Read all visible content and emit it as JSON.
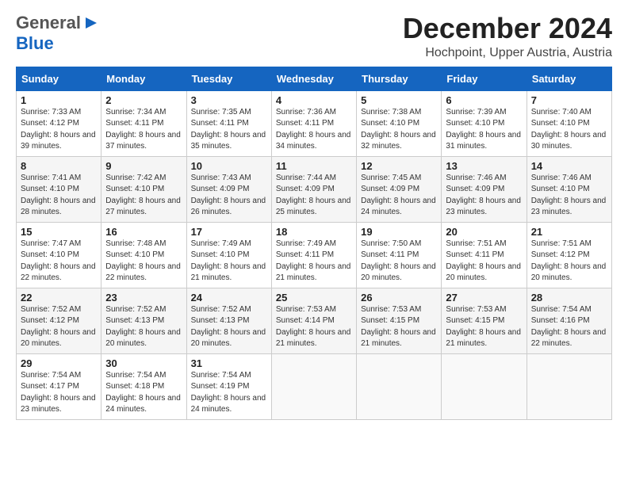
{
  "header": {
    "logo_general": "General",
    "logo_blue": "Blue",
    "title": "December 2024",
    "location": "Hochpoint, Upper Austria, Austria"
  },
  "weekdays": [
    "Sunday",
    "Monday",
    "Tuesday",
    "Wednesday",
    "Thursday",
    "Friday",
    "Saturday"
  ],
  "weeks": [
    [
      {
        "day": "1",
        "sunrise": "Sunrise: 7:33 AM",
        "sunset": "Sunset: 4:12 PM",
        "daylight": "Daylight: 8 hours and 39 minutes."
      },
      {
        "day": "2",
        "sunrise": "Sunrise: 7:34 AM",
        "sunset": "Sunset: 4:11 PM",
        "daylight": "Daylight: 8 hours and 37 minutes."
      },
      {
        "day": "3",
        "sunrise": "Sunrise: 7:35 AM",
        "sunset": "Sunset: 4:11 PM",
        "daylight": "Daylight: 8 hours and 35 minutes."
      },
      {
        "day": "4",
        "sunrise": "Sunrise: 7:36 AM",
        "sunset": "Sunset: 4:11 PM",
        "daylight": "Daylight: 8 hours and 34 minutes."
      },
      {
        "day": "5",
        "sunrise": "Sunrise: 7:38 AM",
        "sunset": "Sunset: 4:10 PM",
        "daylight": "Daylight: 8 hours and 32 minutes."
      },
      {
        "day": "6",
        "sunrise": "Sunrise: 7:39 AM",
        "sunset": "Sunset: 4:10 PM",
        "daylight": "Daylight: 8 hours and 31 minutes."
      },
      {
        "day": "7",
        "sunrise": "Sunrise: 7:40 AM",
        "sunset": "Sunset: 4:10 PM",
        "daylight": "Daylight: 8 hours and 30 minutes."
      }
    ],
    [
      {
        "day": "8",
        "sunrise": "Sunrise: 7:41 AM",
        "sunset": "Sunset: 4:10 PM",
        "daylight": "Daylight: 8 hours and 28 minutes."
      },
      {
        "day": "9",
        "sunrise": "Sunrise: 7:42 AM",
        "sunset": "Sunset: 4:10 PM",
        "daylight": "Daylight: 8 hours and 27 minutes."
      },
      {
        "day": "10",
        "sunrise": "Sunrise: 7:43 AM",
        "sunset": "Sunset: 4:09 PM",
        "daylight": "Daylight: 8 hours and 26 minutes."
      },
      {
        "day": "11",
        "sunrise": "Sunrise: 7:44 AM",
        "sunset": "Sunset: 4:09 PM",
        "daylight": "Daylight: 8 hours and 25 minutes."
      },
      {
        "day": "12",
        "sunrise": "Sunrise: 7:45 AM",
        "sunset": "Sunset: 4:09 PM",
        "daylight": "Daylight: 8 hours and 24 minutes."
      },
      {
        "day": "13",
        "sunrise": "Sunrise: 7:46 AM",
        "sunset": "Sunset: 4:09 PM",
        "daylight": "Daylight: 8 hours and 23 minutes."
      },
      {
        "day": "14",
        "sunrise": "Sunrise: 7:46 AM",
        "sunset": "Sunset: 4:10 PM",
        "daylight": "Daylight: 8 hours and 23 minutes."
      }
    ],
    [
      {
        "day": "15",
        "sunrise": "Sunrise: 7:47 AM",
        "sunset": "Sunset: 4:10 PM",
        "daylight": "Daylight: 8 hours and 22 minutes."
      },
      {
        "day": "16",
        "sunrise": "Sunrise: 7:48 AM",
        "sunset": "Sunset: 4:10 PM",
        "daylight": "Daylight: 8 hours and 22 minutes."
      },
      {
        "day": "17",
        "sunrise": "Sunrise: 7:49 AM",
        "sunset": "Sunset: 4:10 PM",
        "daylight": "Daylight: 8 hours and 21 minutes."
      },
      {
        "day": "18",
        "sunrise": "Sunrise: 7:49 AM",
        "sunset": "Sunset: 4:11 PM",
        "daylight": "Daylight: 8 hours and 21 minutes."
      },
      {
        "day": "19",
        "sunrise": "Sunrise: 7:50 AM",
        "sunset": "Sunset: 4:11 PM",
        "daylight": "Daylight: 8 hours and 20 minutes."
      },
      {
        "day": "20",
        "sunrise": "Sunrise: 7:51 AM",
        "sunset": "Sunset: 4:11 PM",
        "daylight": "Daylight: 8 hours and 20 minutes."
      },
      {
        "day": "21",
        "sunrise": "Sunrise: 7:51 AM",
        "sunset": "Sunset: 4:12 PM",
        "daylight": "Daylight: 8 hours and 20 minutes."
      }
    ],
    [
      {
        "day": "22",
        "sunrise": "Sunrise: 7:52 AM",
        "sunset": "Sunset: 4:12 PM",
        "daylight": "Daylight: 8 hours and 20 minutes."
      },
      {
        "day": "23",
        "sunrise": "Sunrise: 7:52 AM",
        "sunset": "Sunset: 4:13 PM",
        "daylight": "Daylight: 8 hours and 20 minutes."
      },
      {
        "day": "24",
        "sunrise": "Sunrise: 7:52 AM",
        "sunset": "Sunset: 4:13 PM",
        "daylight": "Daylight: 8 hours and 20 minutes."
      },
      {
        "day": "25",
        "sunrise": "Sunrise: 7:53 AM",
        "sunset": "Sunset: 4:14 PM",
        "daylight": "Daylight: 8 hours and 21 minutes."
      },
      {
        "day": "26",
        "sunrise": "Sunrise: 7:53 AM",
        "sunset": "Sunset: 4:15 PM",
        "daylight": "Daylight: 8 hours and 21 minutes."
      },
      {
        "day": "27",
        "sunrise": "Sunrise: 7:53 AM",
        "sunset": "Sunset: 4:15 PM",
        "daylight": "Daylight: 8 hours and 21 minutes."
      },
      {
        "day": "28",
        "sunrise": "Sunrise: 7:54 AM",
        "sunset": "Sunset: 4:16 PM",
        "daylight": "Daylight: 8 hours and 22 minutes."
      }
    ],
    [
      {
        "day": "29",
        "sunrise": "Sunrise: 7:54 AM",
        "sunset": "Sunset: 4:17 PM",
        "daylight": "Daylight: 8 hours and 23 minutes."
      },
      {
        "day": "30",
        "sunrise": "Sunrise: 7:54 AM",
        "sunset": "Sunset: 4:18 PM",
        "daylight": "Daylight: 8 hours and 24 minutes."
      },
      {
        "day": "31",
        "sunrise": "Sunrise: 7:54 AM",
        "sunset": "Sunset: 4:19 PM",
        "daylight": "Daylight: 8 hours and 24 minutes."
      },
      null,
      null,
      null,
      null
    ]
  ]
}
